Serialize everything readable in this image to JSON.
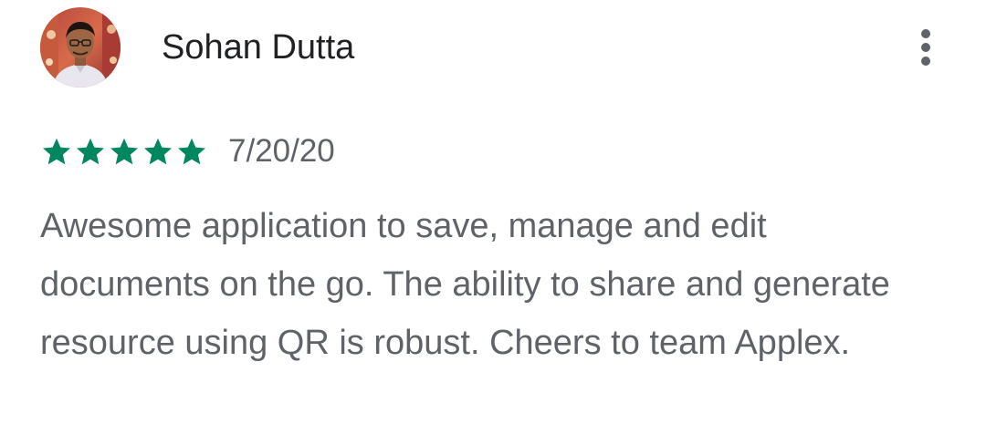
{
  "review": {
    "reviewer_name": "Sohan Dutta",
    "avatar_icon": "user-avatar",
    "more_icon": "more-vert-icon",
    "rating": 5,
    "rating_max": 5,
    "star_icon": "star-icon",
    "date": "7/20/20",
    "text": "Awesome application to save, manage and edit documents on the go. The ability to share and generate resource using QR is robust. Cheers to team Applex."
  },
  "colors": {
    "star": "#01875f",
    "name": "#202124",
    "secondary_text": "#5f6368",
    "background": "#ffffff"
  }
}
